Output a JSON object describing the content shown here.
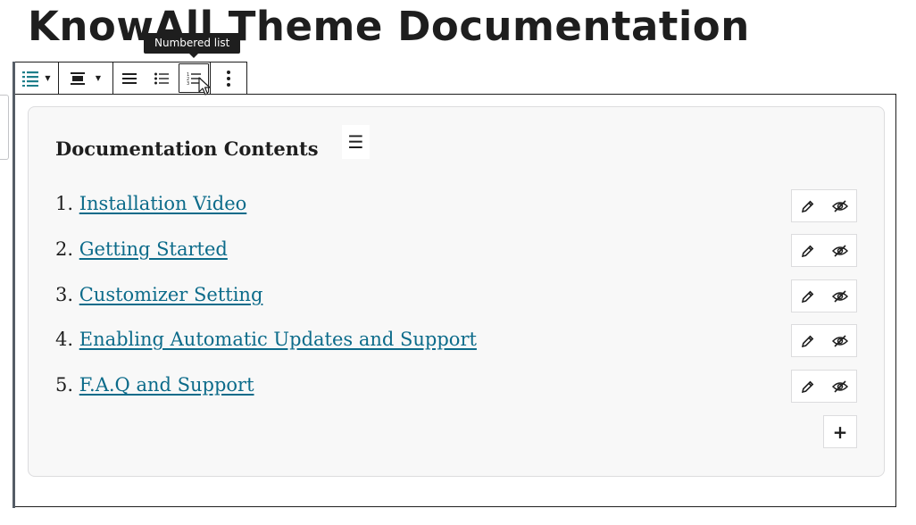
{
  "page": {
    "title": "KnowAll Theme Documentation"
  },
  "toolbar": {
    "tooltip": "Numbered list",
    "icons": [
      "list-style-icon",
      "align-icon",
      "justify-icon",
      "bulleted-list-icon",
      "numbered-list-icon",
      "more-options-icon"
    ],
    "active": "numbered-list-icon"
  },
  "toc": {
    "heading": "Documentation Contents",
    "items": [
      {
        "num": "1.",
        "label": "Installation Video"
      },
      {
        "num": "2.",
        "label": "Getting Started"
      },
      {
        "num": "3.",
        "label": "Customizer Setting"
      },
      {
        "num": "4.",
        "label": "Enabling Automatic Updates and Support"
      },
      {
        "num": "5.",
        "label": "F.A.Q and Support"
      }
    ],
    "handle_icon": "menu-icon",
    "add_icon": "plus-icon",
    "add_symbol": "+",
    "handle_symbol": "☰"
  },
  "colors": {
    "accent": "#0c6b8a",
    "list_icon": "#1e7e8a",
    "dark": "#1e1e1e"
  }
}
